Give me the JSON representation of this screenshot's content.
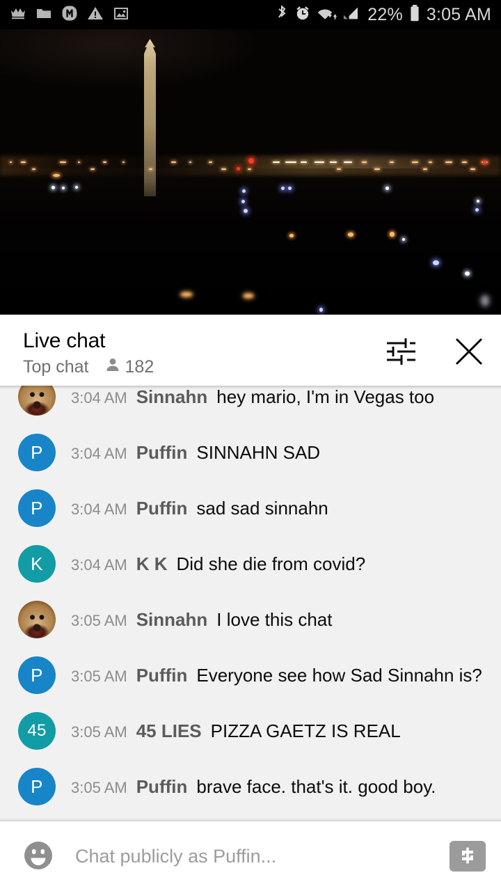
{
  "status_bar": {
    "left_icons": [
      {
        "name": "crown-icon"
      },
      {
        "name": "folder-icon"
      },
      {
        "name": "m-badge-icon"
      },
      {
        "name": "warning-triangle-icon"
      },
      {
        "name": "image-icon"
      }
    ],
    "right_icons": [
      {
        "name": "bluetooth-icon"
      },
      {
        "name": "alarm-clock-icon"
      },
      {
        "name": "wifi-icon"
      },
      {
        "name": "cellular-signal-icon"
      }
    ],
    "battery_percent": "22%",
    "battery_icon": "battery-icon",
    "clock": "3:05 AM"
  },
  "video": {
    "name": "live-video-player",
    "scene": "washington-monument-night-skyline",
    "progress_percent": 100,
    "progress_color": "#e62117"
  },
  "chat_header": {
    "title": "Live chat",
    "mode_label": "Top chat",
    "viewer_icon": "person-icon",
    "viewer_count": "182",
    "settings_icon": "tune-sliders-icon",
    "close_icon": "close-x-icon"
  },
  "chat": {
    "messages": [
      {
        "time": "3:04 AM",
        "author": "Sinnahn",
        "text": "hey mario, I'm in Vegas too",
        "avatar_type": "photo",
        "avatar_initials": "",
        "avatar_color": "#a8763f"
      },
      {
        "time": "3:04 AM",
        "author": "Puffin",
        "text": "SINNAHN SAD",
        "avatar_type": "initials",
        "avatar_initials": "P",
        "avatar_color": "#1785c8"
      },
      {
        "time": "3:04 AM",
        "author": "Puffin",
        "text": "sad sad sinnahn",
        "avatar_type": "initials",
        "avatar_initials": "P",
        "avatar_color": "#1785c8"
      },
      {
        "time": "3:04 AM",
        "author": "K K",
        "text": "Did she die from covid?",
        "avatar_type": "initials",
        "avatar_initials": "K",
        "avatar_color": "#129ca5"
      },
      {
        "time": "3:05 AM",
        "author": "Sinnahn",
        "text": "I love this chat",
        "avatar_type": "photo",
        "avatar_initials": "",
        "avatar_color": "#a8763f"
      },
      {
        "time": "3:05 AM",
        "author": "Puffin",
        "text": "Everyone see how Sad Sinnahn is?",
        "avatar_type": "initials",
        "avatar_initials": "P",
        "avatar_color": "#1785c8"
      },
      {
        "time": "3:05 AM",
        "author": "45 LIES",
        "text": "PIZZA GAETZ IS REAL",
        "avatar_type": "number",
        "avatar_initials": "45",
        "avatar_color": "#129ca5"
      },
      {
        "time": "3:05 AM",
        "author": "Puffin",
        "text": "brave face. that's it. good boy.",
        "avatar_type": "initials",
        "avatar_initials": "P",
        "avatar_color": "#1785c8"
      }
    ]
  },
  "input_bar": {
    "emoji_icon": "emoji-smiley-icon",
    "placeholder": "Chat publicly as Puffin...",
    "value": "",
    "superchat_icon": "dollar-sign-icon"
  }
}
